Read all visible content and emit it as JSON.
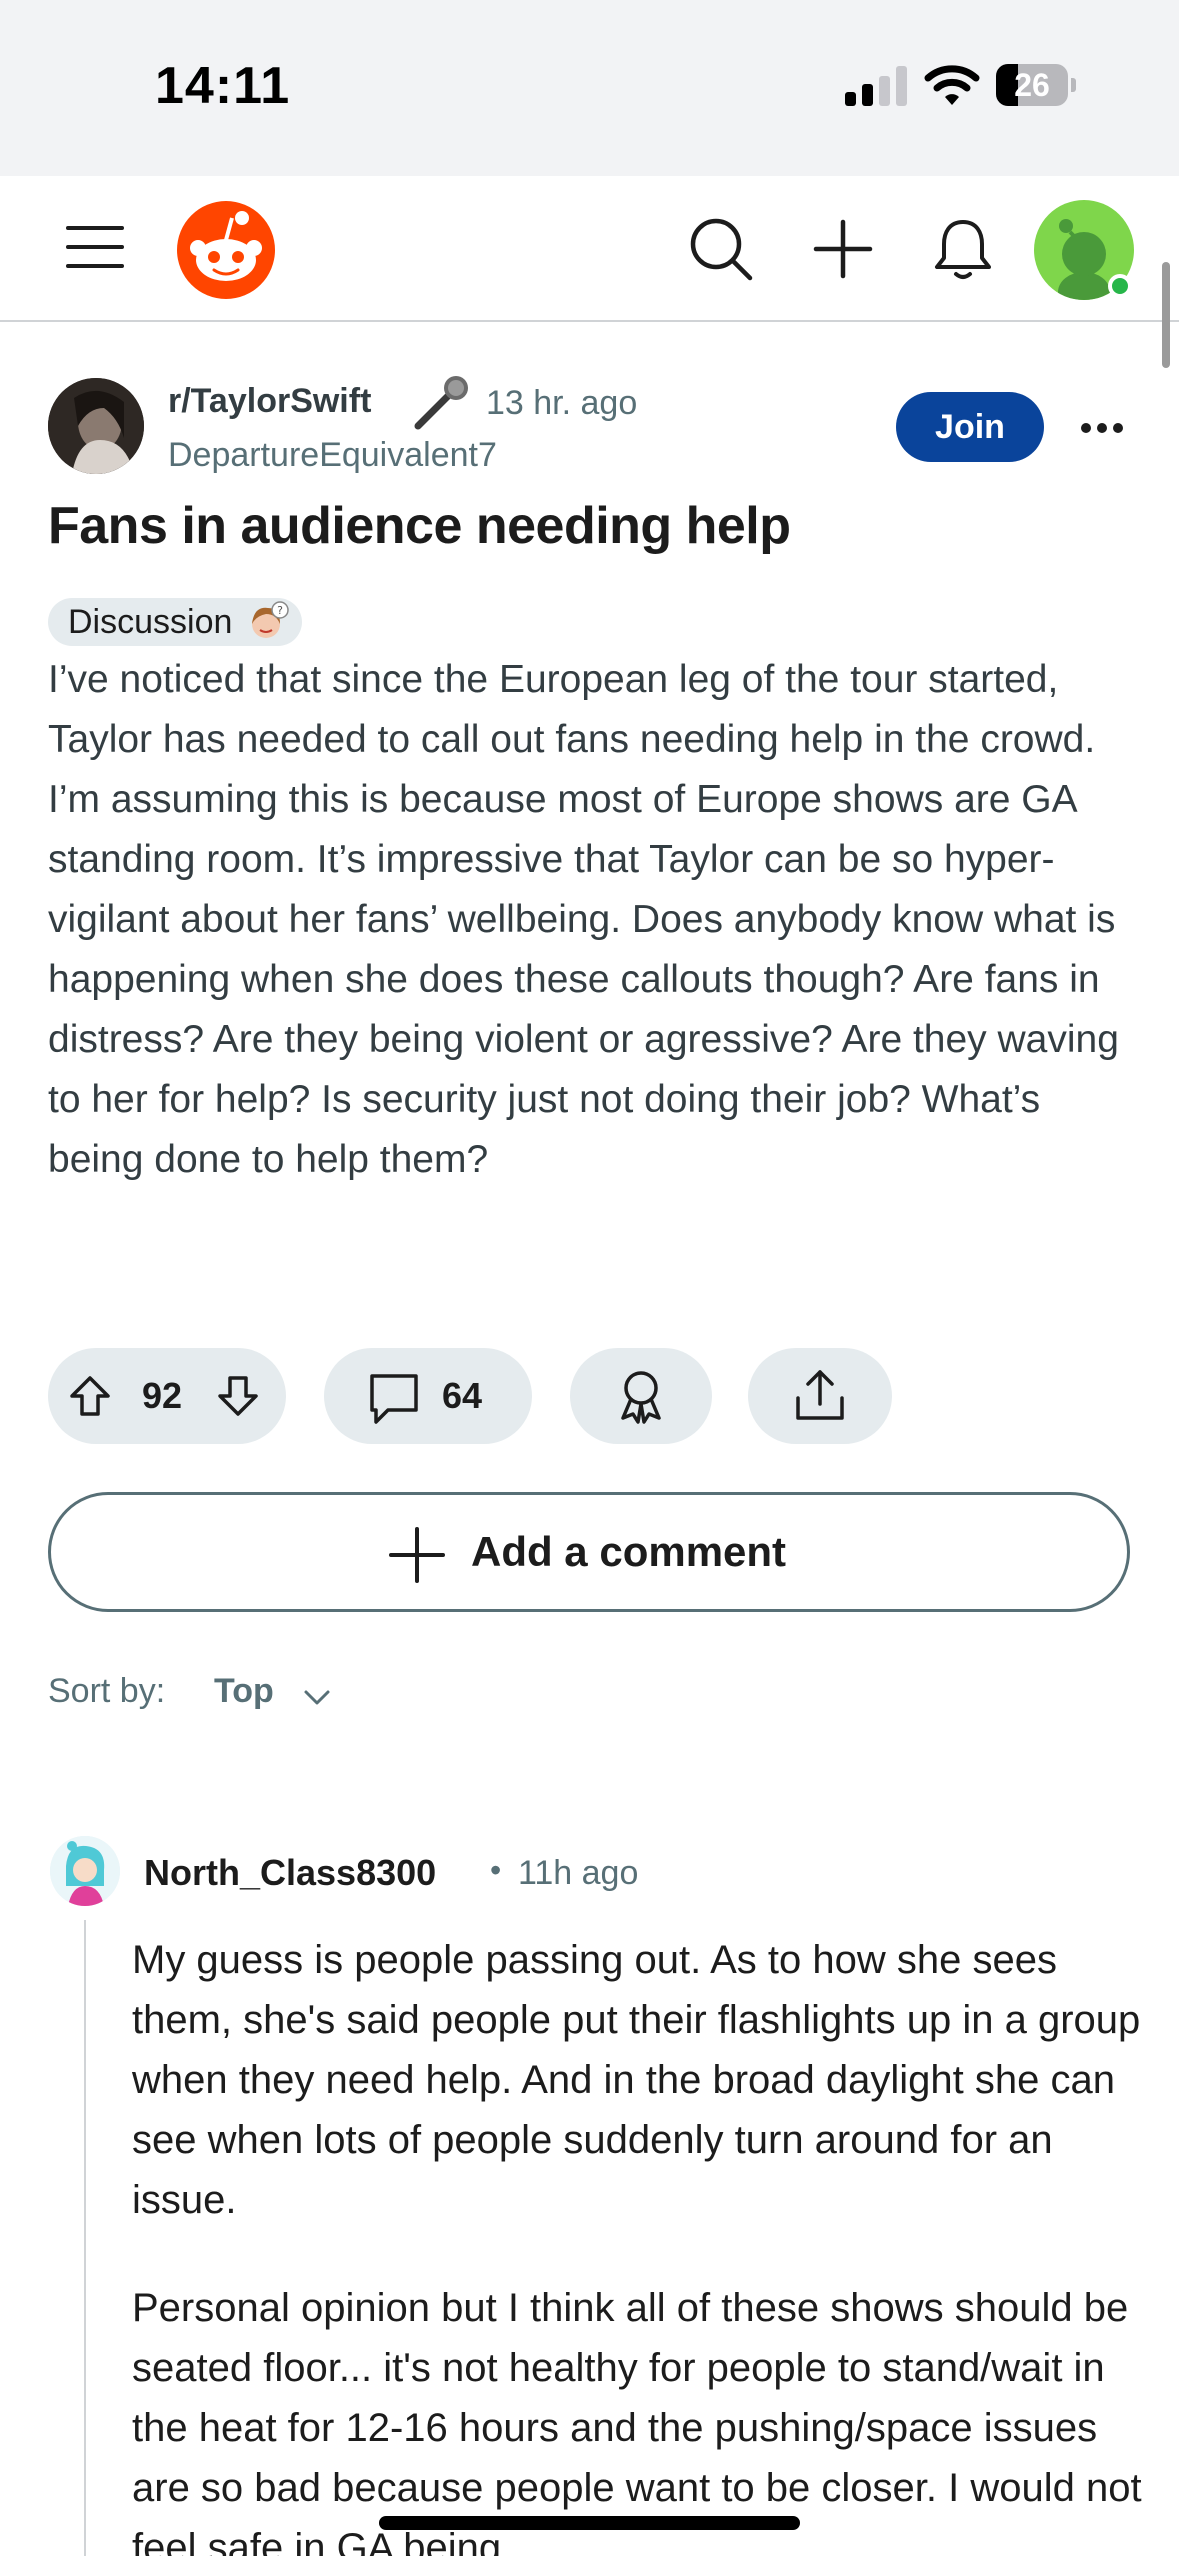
{
  "status_bar": {
    "time": "14:11",
    "battery": "26"
  },
  "nav": {
    "icons": [
      "menu-icon",
      "reddit-logo",
      "search-icon",
      "plus-icon",
      "bell-icon",
      "avatar"
    ]
  },
  "post": {
    "subreddit": "r/TaylorSwift",
    "time": "13 hr. ago",
    "author": "DepartureEquivalent7",
    "join_label": "Join",
    "title": "Fans in audience needing help",
    "flair": "Discussion",
    "body": "I’ve noticed that since the European leg of the tour started, Taylor has needed to call out fans needing help in the crowd. I’m assuming this is because most of Europe shows are GA standing room. It’s impressive that Taylor can be so hyper-vigilant about her fans’ wellbeing. Does anybody know what is happening when she does these callouts though? Are fans in distress? Are they being violent or agressive? Are they waving to her for help? Is security just not doing their job? What’s being done to help them?",
    "votes": "92",
    "comments": "64"
  },
  "add_comment_label": "Add a comment",
  "sort": {
    "label": "Sort by:",
    "value": "Top"
  },
  "comment": {
    "author": "North_Class8300",
    "separator": "•",
    "time": "11h ago",
    "paragraphs": [
      "My guess is people passing out. As to how she sees them, she's said people put their flashlights up in a group when they need help. And in the broad daylight she can see when lots of people suddenly turn around for an issue.",
      "Personal opinion but I think all of these shows should be seated floor... it's not healthy for people to stand/wait in the heat for 12-16 hours and the pushing/space issues are so bad because people want to be closer. I would not feel safe in GA being"
    ]
  },
  "colors": {
    "join": "#0a449b",
    "reddit_orange": "#ff4500",
    "pill_bg": "#e5ebee",
    "meta_text": "#576f76"
  }
}
